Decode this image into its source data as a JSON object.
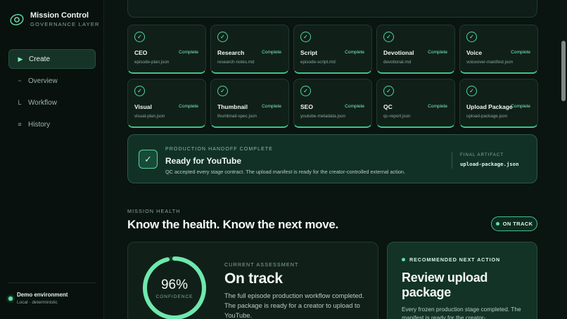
{
  "brand": {
    "title": "Mission Control",
    "subtitle": "GOVERNANCE LAYER"
  },
  "nav": [
    {
      "label": "Create",
      "icon": "play-icon",
      "glyph": "▶",
      "active": true
    },
    {
      "label": "Overview",
      "icon": "wave-icon",
      "glyph": "~",
      "active": false
    },
    {
      "label": "Workflow",
      "icon": "branch-icon",
      "glyph": "L",
      "active": false
    },
    {
      "label": "History",
      "icon": "list-icon",
      "glyph": "≡",
      "active": false
    }
  ],
  "environment": {
    "title": "Demo environment",
    "subtitle": "Local · deterministic"
  },
  "stages": [
    {
      "name": "CEO",
      "status": "Complete",
      "file": "episode-plan.json"
    },
    {
      "name": "Research",
      "status": "Complete",
      "file": "research-notes.md"
    },
    {
      "name": "Script",
      "status": "Complete",
      "file": "episode-script.md"
    },
    {
      "name": "Devotional",
      "status": "Complete",
      "file": "devotional.md"
    },
    {
      "name": "Voice",
      "status": "Complete",
      "file": "voiceover-manifest.json"
    },
    {
      "name": "Visual",
      "status": "Complete",
      "file": "visual-plan.json"
    },
    {
      "name": "Thumbnail",
      "status": "Complete",
      "file": "thumbnail-spec.json"
    },
    {
      "name": "SEO",
      "status": "Complete",
      "file": "youtube-metadata.json"
    },
    {
      "name": "QC",
      "status": "Complete",
      "file": "qc-report.json"
    },
    {
      "name": "Upload Package",
      "status": "Complete",
      "file": "upload-package.json"
    }
  ],
  "handoff": {
    "label": "PRODUCTION HANDOFF COMPLETE",
    "title": "Ready for YouTube",
    "description": "QC accepted every stage contract. The upload manifest is ready for the creator-controlled external action.",
    "artifact_label": "FINAL ARTIFACT",
    "artifact_value": "upload-package.json"
  },
  "health": {
    "label": "MISSION HEALTH",
    "title": "Know the health. Know the next move.",
    "badge": "ON TRACK"
  },
  "assessment": {
    "percent": 96,
    "percent_text": "96%",
    "caption": "CONFIDENCE",
    "label": "CURRENT ASSESSMENT",
    "title": "On track",
    "description": "The full episode production workflow completed. The package is ready for a creator to upload to YouTube."
  },
  "next_action": {
    "label": "RECOMMENDED NEXT ACTION",
    "title": "Review upload package",
    "description": "Every frozen production stage completed. The manifest is ready for the creator-"
  },
  "colors": {
    "accent": "#5fe0a3",
    "background": "#0a1411",
    "card": "#102019"
  }
}
